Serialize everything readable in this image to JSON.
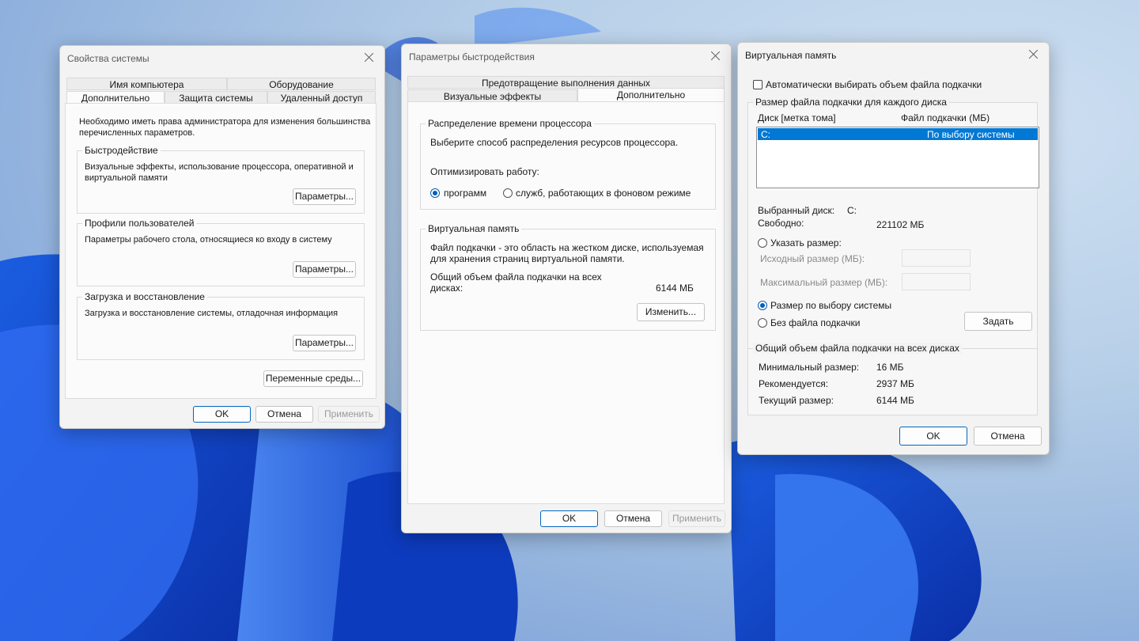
{
  "win1": {
    "title": "Свойства системы",
    "tabs_row1": [
      "Имя компьютера",
      "Оборудование"
    ],
    "tabs_row2": [
      "Дополнительно",
      "Защита системы",
      "Удаленный доступ"
    ],
    "admin_note": "Необходимо иметь права администратора для изменения большинства перечисленных параметров.",
    "groups": [
      {
        "title": "Быстродействие",
        "desc": "Визуальные эффекты, использование процессора, оперативной и виртуальной памяти",
        "button": "Параметры..."
      },
      {
        "title": "Профили пользователей",
        "desc": "Параметры рабочего стола, относящиеся ко входу в систему",
        "button": "Параметры..."
      },
      {
        "title": "Загрузка и восстановление",
        "desc": "Загрузка и восстановление системы, отладочная информация",
        "button": "Параметры..."
      }
    ],
    "env_button": "Переменные среды...",
    "ok": "OK",
    "cancel": "Отмена",
    "apply": "Применить"
  },
  "win2": {
    "title": "Параметры быстродействия",
    "tab_top": "Предотвращение выполнения данных",
    "tabs_row2": [
      "Визуальные эффекты",
      "Дополнительно"
    ],
    "cpu": {
      "title": "Распределение времени процессора",
      "desc": "Выберите способ распределения ресурсов процессора.",
      "optimize": "Оптимизировать работу:",
      "opt_programs": "программ",
      "opt_services": "служб, работающих в фоновом режиме"
    },
    "vm": {
      "title": "Виртуальная память",
      "desc": "Файл подкачки - это область на жестком диске, используемая для хранения страниц виртуальной памяти.",
      "total_label": "Общий объем файла подкачки на всех дисках:",
      "total_value": "6144 МБ",
      "change": "Изменить..."
    },
    "ok": "OK",
    "cancel": "Отмена",
    "apply": "Применить"
  },
  "win3": {
    "title": "Виртуальная память",
    "auto_label": "Автоматически выбирать объем файла подкачки",
    "per_disk_title": "Размер файла подкачки для каждого диска",
    "col_disk": "Диск [метка тома]",
    "col_size": "Файл подкачки (МБ)",
    "row_disk": "C:",
    "row_size": "По выбору системы",
    "selected_label": "Выбранный диск:",
    "selected_value": "C:",
    "free_label": "Свободно:",
    "free_value": "221102 МБ",
    "opt_custom": "Указать размер:",
    "initial_label": "Исходный размер (МБ):",
    "max_label": "Максимальный размер (МБ):",
    "opt_system": "Размер по выбору системы",
    "opt_none": "Без файла подкачки",
    "set": "Задать",
    "total_title": "Общий объем файла подкачки на всех дисках",
    "min_label": "Минимальный размер:",
    "min_value": "16 МБ",
    "rec_label": "Рекомендуется:",
    "rec_value": "2937 МБ",
    "cur_label": "Текущий размер:",
    "cur_value": "6144 МБ",
    "ok": "OK",
    "cancel": "Отмена"
  }
}
